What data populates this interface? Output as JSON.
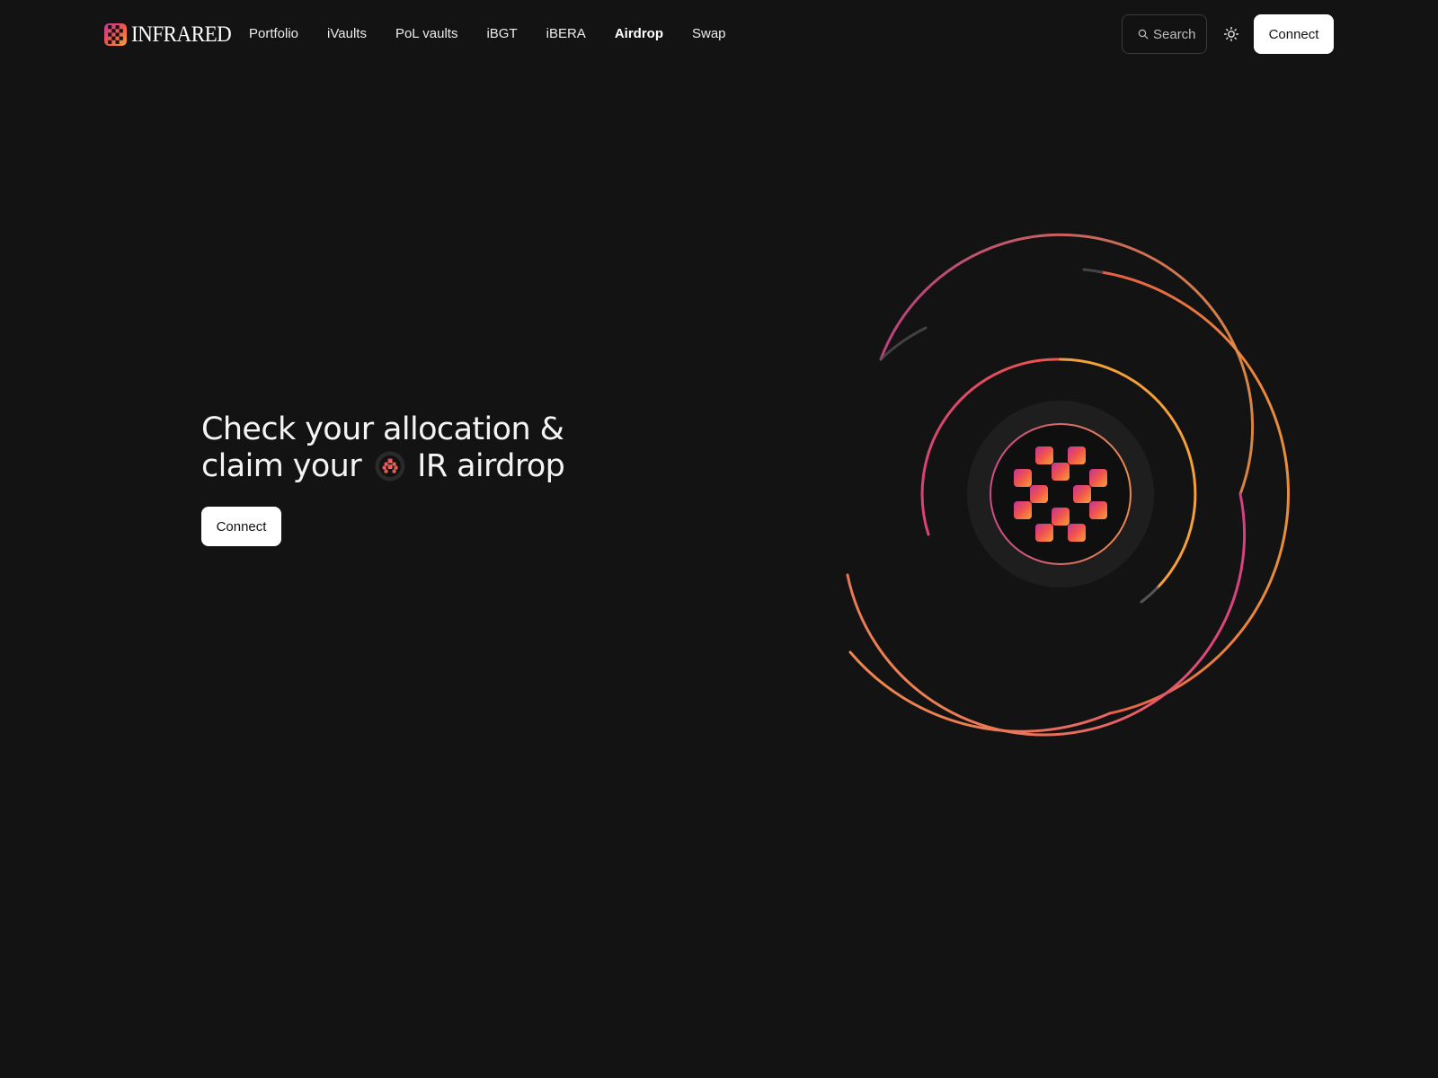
{
  "brand": {
    "name": "INFRARED",
    "colors": {
      "magenta": "#c2349a",
      "red": "#f2554b",
      "orange": "#f5a13a"
    }
  },
  "nav": {
    "items": [
      {
        "label": "Portfolio",
        "active": false
      },
      {
        "label": "iVaults",
        "active": false
      },
      {
        "label": "PoL vaults",
        "active": false
      },
      {
        "label": "iBGT",
        "active": false
      },
      {
        "label": "iBERA",
        "active": false
      },
      {
        "label": "Airdrop",
        "active": true
      },
      {
        "label": "Swap",
        "active": false
      }
    ]
  },
  "search": {
    "placeholder": "Search",
    "icon": "search-icon"
  },
  "theme_toggle": {
    "icon": "sun-icon"
  },
  "header": {
    "connect_label": "Connect"
  },
  "hero": {
    "title_line1": "Check your allocation &",
    "title_line2_prefix": "claim your",
    "token_icon": "ir-token-icon",
    "title_line2_suffix": "IR airdrop",
    "connect_label": "Connect"
  }
}
